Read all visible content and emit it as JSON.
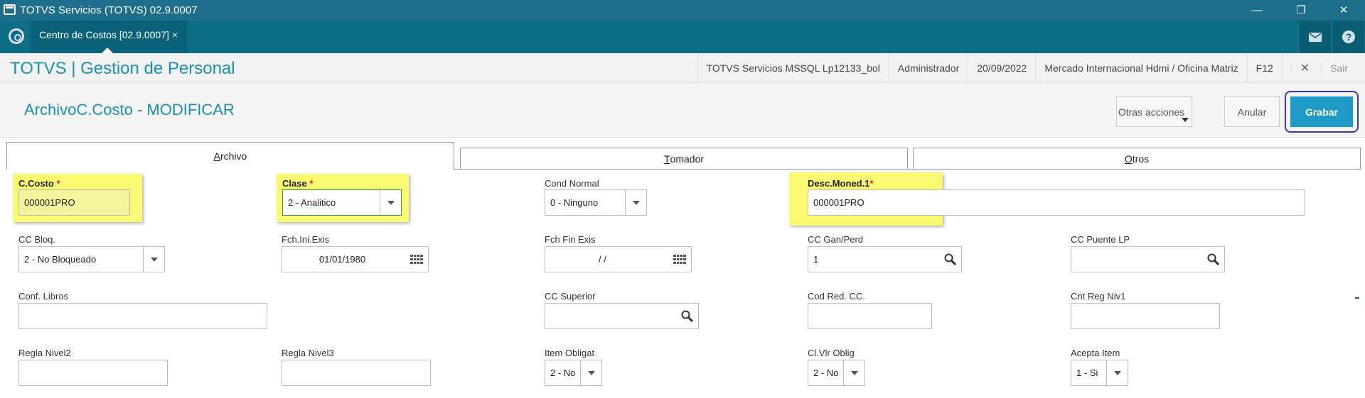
{
  "window": {
    "title": "TOTVS Servicios (TOTVS) 02.9.0007",
    "min": "—",
    "restore": "❐",
    "close": "✕"
  },
  "tabbar": {
    "tab_label": "Centro de Costos [02.9.0007]",
    "tab_close": "×",
    "mail_icon": "mail-icon",
    "help_icon": "help-icon"
  },
  "environment": {
    "brand": "TOTVS | Gestion de Personal",
    "server": "TOTVS Servicios MSSQL Lp12133_bol",
    "user": "Administrador",
    "date": "20/09/2022",
    "company": "Mercado Internacional Hdmi / Oficina Matriz",
    "shortcut": "F12",
    "exit": "Sair"
  },
  "page": {
    "title": "ArchivoC.Costo - MODIFICAR"
  },
  "actions": {
    "other": "Otras acciones",
    "cancel": "Anular",
    "save": "Grabar"
  },
  "folders": [
    {
      "pre": "",
      "key": "A",
      "post": "rchivo"
    },
    {
      "pre": "",
      "key": "T",
      "post": "omador"
    },
    {
      "pre": "",
      "key": "O",
      "post": "tros"
    }
  ],
  "fields": {
    "ccosto": {
      "label": "C.Costo",
      "req": "*",
      "value": "000001PRO"
    },
    "clase": {
      "label": "Clase",
      "req": "*",
      "value": "2 - Analitico"
    },
    "cond_normal": {
      "label": "Cond Normal",
      "value": "0 - Ninguno"
    },
    "desc_moned": {
      "label": "Desc.Moned.1",
      "req": "*",
      "value": "000001PRO"
    },
    "cc_bloq": {
      "label": "CC Bloq.",
      "value": "2 - No Bloqueado"
    },
    "fch_ini": {
      "label": "Fch.Ini.Exis",
      "value": "01/01/1980"
    },
    "fch_fin": {
      "label": "Fch Fin Exis",
      "value": "/  /"
    },
    "cc_gan": {
      "label": "CC Gan/Perd",
      "value": "1"
    },
    "cc_puente": {
      "label": "CC Puente LP",
      "value": ""
    },
    "conf_libros": {
      "label": "Conf. Libros",
      "value": ""
    },
    "cc_superior": {
      "label": "CC Superior",
      "value": ""
    },
    "cod_red": {
      "label": "Cod Red. CC.",
      "value": ""
    },
    "cnt_reg": {
      "label": "Cnt Reg Niv1",
      "value": ""
    },
    "regla2": {
      "label": "Regla Nivel2",
      "value": ""
    },
    "regla3": {
      "label": "Regla Nivel3",
      "value": ""
    },
    "item_oblig": {
      "label": "Item Obligat",
      "value": "2 - No"
    },
    "cl_vlr": {
      "label": "Cl.Vlr Oblig",
      "value": "2 - No"
    },
    "acepta": {
      "label": "Acepta Item",
      "value": "1 - Si"
    }
  },
  "colors": {
    "accent": "#1a8fb3",
    "titlebar": "#1d6d8c",
    "highlight": "#faf972",
    "save": "#1d9ac6"
  }
}
